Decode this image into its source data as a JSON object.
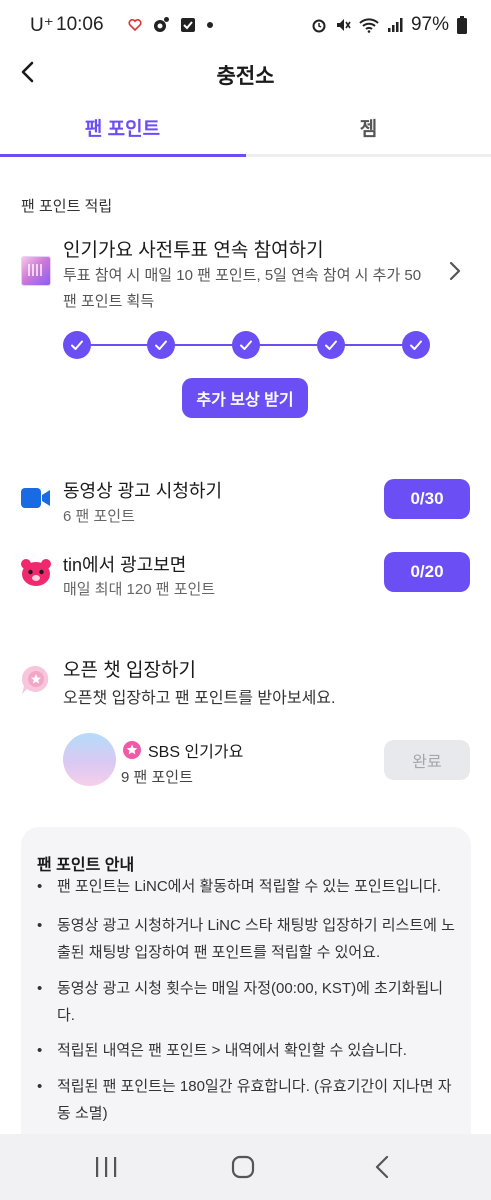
{
  "status_bar": {
    "carrier": "U⁺",
    "time": "10:06",
    "battery": "97%"
  },
  "header": {
    "title": "충전소",
    "back_icon": "chevron-left-icon"
  },
  "tabs": [
    {
      "label": "팬 포인트",
      "active": true
    },
    {
      "label": "젬",
      "active": false
    }
  ],
  "earn_section": {
    "title": "팬 포인트 적립",
    "vote_event": {
      "title": "인기가요 사전투표 연속 참여하기",
      "description": "투표 참여 시 매일 10 팬 포인트, 5일 연속 참여 시 추가 50 팬 포인트 획득",
      "completed_days": 5,
      "total_days": 5,
      "reward_button": "추가 보상 받기"
    },
    "video_ad": {
      "title": "동영상 광고 시청하기",
      "subtitle": "6 팬 포인트",
      "count": "0/30",
      "icon": "video-camera-icon"
    },
    "tin_ad": {
      "title": "tin에서 광고보면",
      "subtitle": "매일 최대 120 팬 포인트",
      "count": "0/20",
      "icon": "bear-icon"
    },
    "open_chat": {
      "title": "오픈 챗 입장하기",
      "subtitle": "오픈챗 입장하고 팬 포인트를 받아보세요.",
      "room": {
        "name": "SBS 인기가요",
        "points": "9 팬 포인트",
        "button": "완료"
      }
    }
  },
  "info": {
    "title": "팬 포인트 안내",
    "items": [
      "팬 포인트는 LiNC에서 활동하며 적립할 수 있는 포인트입니다.",
      "동영상 광고 시청하거나 LiNC 스타 채팅방 입장하기 리스트에 노출된 채팅방 입장하여 팬 포인트를 적립할 수 있어요.",
      "동영상 광고 시청 횟수는 매일 자정(00:00, KST)에 초기화됩니다.",
      "적립된 내역은 팬 포인트 > 내역에서 확인할 수 있습니다.",
      "적립된 팬 포인트는 180일간 유효합니다. (유효기간이 지나면 자동 소멸)"
    ]
  },
  "colors": {
    "accent": "#6c4ef5",
    "video_icon": "#1a6be3",
    "bear_icon": "#f0286e",
    "chat_icon": "#f3a6c8"
  }
}
